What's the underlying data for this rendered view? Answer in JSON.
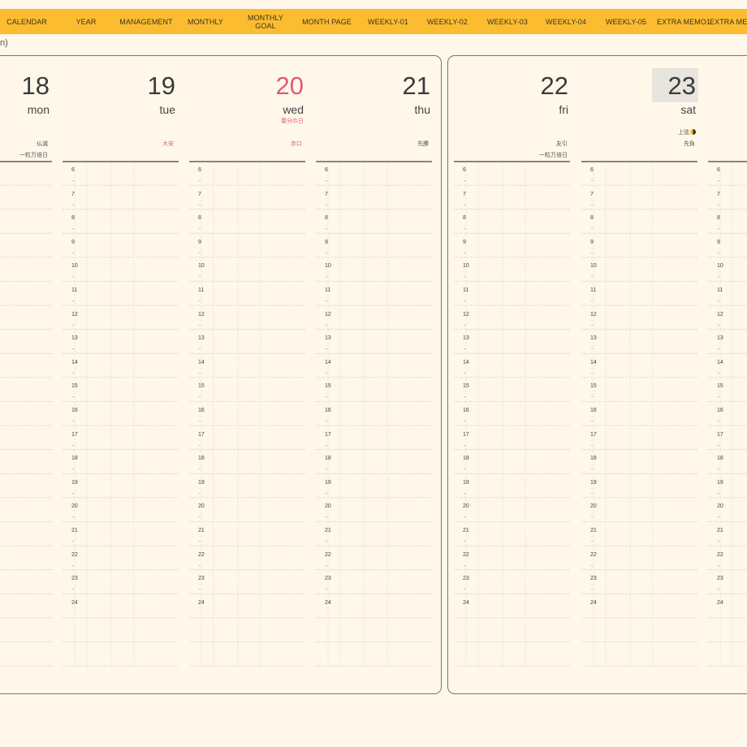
{
  "nav": [
    "CALENDAR",
    "YEAR",
    "MANAGEMENT",
    "MONTHLY",
    "MONTHLY\nGOAL",
    "MONTH PAGE",
    "WEEKLY-01",
    "WEEKLY-02",
    "WEEKLY-03",
    "WEEKLY-04",
    "WEEKLY-05",
    "EXTRA MEMO1",
    "EXTRA ME"
  ],
  "subtitle": "n)",
  "days": [
    {
      "num": "18",
      "name": "mon",
      "rokuyo": "仏滅",
      "note": "一粒万倍日",
      "holiday": false
    },
    {
      "num": "19",
      "name": "tue",
      "rokuyo": "大安",
      "note": "",
      "holiday": false
    },
    {
      "num": "20",
      "name": "wed",
      "holiday_name": "春分の日",
      "rokuyo": "赤口",
      "note": "",
      "holiday": true
    },
    {
      "num": "21",
      "name": "thu",
      "rokuyo": "先勝",
      "note": "",
      "holiday": false
    },
    {
      "num": "22",
      "name": "fri",
      "rokuyo": "友引",
      "note": "一粒万倍日",
      "holiday": false
    },
    {
      "num": "23",
      "name": "sat",
      "moon": "上弦",
      "rokuyo": "先負",
      "note": "",
      "holiday": false,
      "today": true
    }
  ],
  "hours": [
    "6",
    "7",
    "8",
    "9",
    "10",
    "11",
    "12",
    "13",
    "14",
    "15",
    "16",
    "17",
    "18",
    "19",
    "20",
    "21",
    "22",
    "23",
    "24"
  ],
  "half_mark": "-",
  "colors": {
    "nav_bg": "#fbbd2f",
    "background": "#fff8ea",
    "holiday": "#e05a7a",
    "border": "#7e7364"
  }
}
